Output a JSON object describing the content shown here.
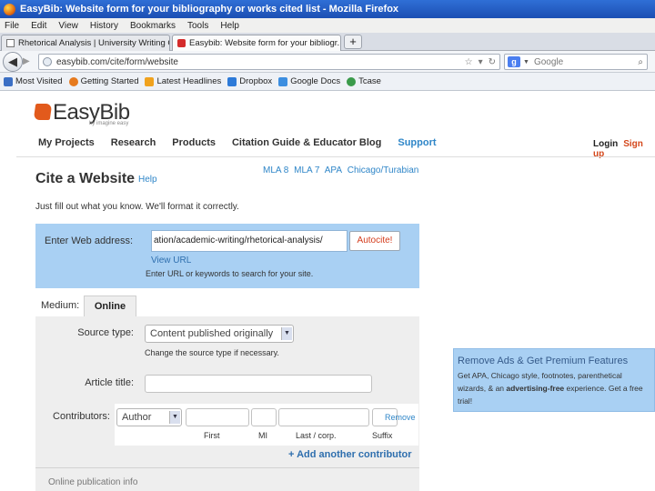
{
  "browser": {
    "window_title": "EasyBib: Website form for your bibliography or works cited list - Mozilla Firefox",
    "menu": [
      "File",
      "Edit",
      "View",
      "History",
      "Bookmarks",
      "Tools",
      "Help"
    ],
    "tabs": [
      {
        "label": "Rhetorical Analysis | University Writing C...",
        "active": false
      },
      {
        "label": "Easybib: Website form for your bibliogr...",
        "active": true
      }
    ],
    "new_tab": "+",
    "url": "easybib.com/cite/form/website",
    "search_placeholder": "Google",
    "bookmarks": [
      {
        "label": "Most Visited",
        "icon": "most-visited-icon",
        "color": "#3b6fc4"
      },
      {
        "label": "Getting Started",
        "icon": "firefox-icon",
        "color": "#e67a1e"
      },
      {
        "label": "Latest Headlines",
        "icon": "rss-icon",
        "color": "#f0a21e"
      },
      {
        "label": "Dropbox",
        "icon": "dropbox-icon",
        "color": "#2d7ad8"
      },
      {
        "label": "Google Docs",
        "icon": "google-docs-icon",
        "color": "#3c8ee0"
      },
      {
        "label": "Tcase",
        "icon": "tcase-icon",
        "color": "#3a9a4a"
      }
    ]
  },
  "site": {
    "logo": "EasyBib",
    "tagline": "by imagine easy",
    "nav": [
      "My Projects",
      "Research",
      "Products",
      "Citation Guide & Educator Blog",
      "Support"
    ],
    "login": "Login",
    "signup": "Sign up"
  },
  "cite": {
    "title": "Cite a Website",
    "help": "Help",
    "styles": [
      "MLA 8",
      "MLA 7",
      "APA",
      "Chicago/Turabian"
    ],
    "intro": "Just fill out what you know. We'll format it correctly.",
    "web_label": "Enter Web address:",
    "web_value": "ation/academic-writing/rhetorical-analysis/",
    "autocite": "Autocite!",
    "view_url": "View URL",
    "web_hint": "Enter URL or keywords to search for your site."
  },
  "form": {
    "medium_label": "Medium:",
    "medium_tab": "Online",
    "source_type_label": "Source type:",
    "source_type_value": "Content published originally",
    "source_type_help": "Change the source type if necessary.",
    "article_title_label": "Article title:",
    "contributors_label": "Contributors:",
    "contributor_role": "Author",
    "first_label": "First",
    "mi_label": "MI",
    "last_label": "Last / corp.",
    "suffix_label": "Suffix",
    "remove": "Remove",
    "add_contributor": "+ Add another contributor",
    "online_info": "Online publication info"
  },
  "promo": {
    "title": "Remove Ads & Get Premium Features",
    "body_before": "Get APA, Chicago style, footnotes, parenthetical wizards, & an ",
    "body_bold": "advertising-free",
    "body_after": " experience. Get a free trial!"
  },
  "colors": {
    "accent": "#2f86c8",
    "brand": "#e25a1c",
    "panel": "#a9d0f3"
  }
}
